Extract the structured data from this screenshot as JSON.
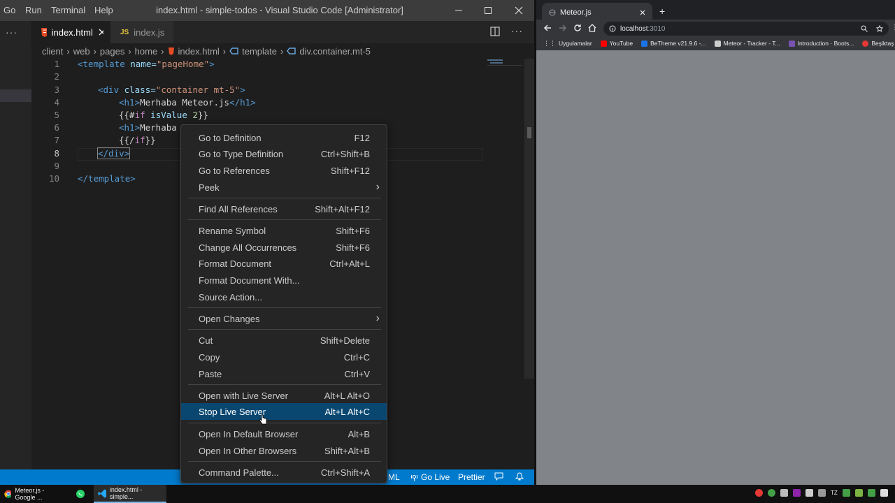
{
  "vscode": {
    "menu": [
      "Go",
      "Run",
      "Terminal",
      "Help"
    ],
    "window_title": "index.html - simple-todos - Visual Studio Code [Administrator]",
    "tabs": [
      {
        "label": "index.html",
        "icon": "html-file-icon"
      },
      {
        "label": "index.js",
        "icon": "js-file-icon"
      }
    ],
    "breadcrumb": [
      "client",
      "web",
      "pages",
      "home",
      "index.html",
      "template",
      "div.container.mt-5"
    ],
    "line_numbers": [
      "1",
      "2",
      "3",
      "4",
      "5",
      "6",
      "7",
      "8",
      "9",
      "10"
    ],
    "code": {
      "l1_tag_open": "<template",
      "l1_attr": " name=",
      "l1_str": "\"pageHome\"",
      "l1_close": ">",
      "l3_tag_open": "<div",
      "l3_attr": " class=",
      "l3_str": "\"container mt-5\"",
      "l3_close": ">",
      "l4_open": "<h1>",
      "l4_text": "Merhaba Meteor.js",
      "l4_close": "</h1>",
      "l5_a": "{{#",
      "l5_kw": "if",
      "l5_b": " isValue ",
      "l5_num": "2",
      "l5_c": "}}",
      "l6_open": "<h1>",
      "l6_text": "Merhaba",
      "l7_a": "{{/",
      "l7_kw": "if",
      "l7_c": "}}",
      "l8": "</div>",
      "l10": "</template>"
    },
    "status": {
      "lang": "ML",
      "go_live": "Go Live",
      "prettier": "Prettier"
    },
    "context_menu": [
      {
        "label": "Go to Definition",
        "shortcut": "F12"
      },
      {
        "label": "Go to Type Definition",
        "shortcut": "Ctrl+Shift+B"
      },
      {
        "label": "Go to References",
        "shortcut": "Shift+F12"
      },
      {
        "label": "Peek",
        "shortcut": "›"
      },
      {
        "label": "Find All References",
        "shortcut": "Shift+Alt+F12"
      },
      {
        "label": "Rename Symbol",
        "shortcut": "Shift+F6"
      },
      {
        "label": "Change All Occurrences",
        "shortcut": "Shift+F6"
      },
      {
        "label": "Format Document",
        "shortcut": "Ctrl+Alt+L"
      },
      {
        "label": "Format Document With...",
        "shortcut": ""
      },
      {
        "label": "Source Action...",
        "shortcut": ""
      },
      {
        "label": "Open Changes",
        "shortcut": "›"
      },
      {
        "label": "Cut",
        "shortcut": "Shift+Delete"
      },
      {
        "label": "Copy",
        "shortcut": "Ctrl+C"
      },
      {
        "label": "Paste",
        "shortcut": "Ctrl+V"
      },
      {
        "label": "Open with Live Server",
        "shortcut": "Alt+L Alt+O"
      },
      {
        "label": "Stop Live Server",
        "shortcut": "Alt+L Alt+C"
      },
      {
        "label": "Open In Default Browser",
        "shortcut": "Alt+B"
      },
      {
        "label": "Open In Other Browsers",
        "shortcut": "Shift+Alt+B"
      },
      {
        "label": "Command Palette...",
        "shortcut": "Ctrl+Shift+A"
      }
    ]
  },
  "browser": {
    "tab_title": "Meteor.js",
    "url_host": "localhost",
    "url_port": ":3010",
    "bookmarks": [
      {
        "label": "Uygulamalar",
        "color": "#e8eaed"
      },
      {
        "label": "YouTube",
        "color": "#ff0000"
      },
      {
        "label": "BeTheme v21.9.6 -...",
        "color": "#1a73e8"
      },
      {
        "label": "Meteor - Tracker - T...",
        "color": "#cccccc"
      },
      {
        "label": "Introduction · Boots...",
        "color": "#7952b3"
      },
      {
        "label": "Beşiktaş Servis",
        "color": "#e53935"
      }
    ]
  },
  "taskbar": {
    "items": [
      {
        "label": "Meteor.js - Google ..."
      },
      {
        "label": ""
      },
      {
        "label": "index.html - simple..."
      }
    ],
    "tray_text": "TZ"
  }
}
